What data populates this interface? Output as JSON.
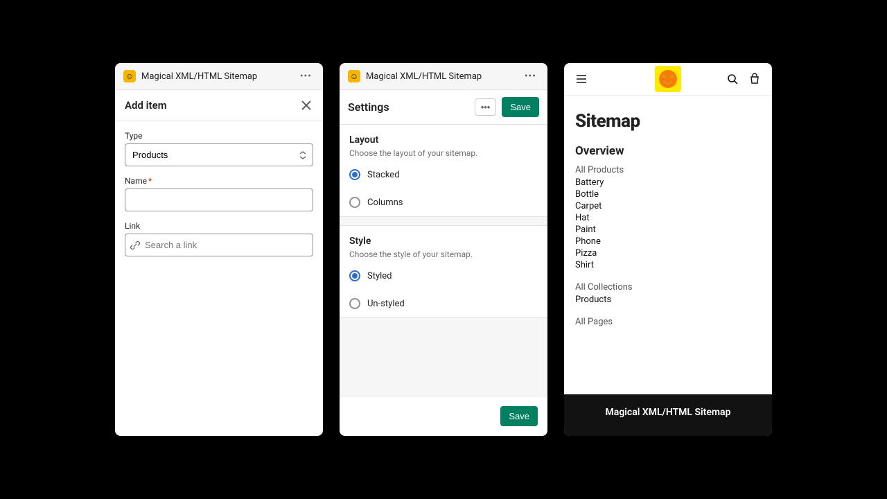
{
  "app_name": "Magical XML/HTML Sitemap",
  "panel1": {
    "title": "Add item",
    "type_label": "Type",
    "type_value": "Products",
    "name_label": "Name",
    "link_label": "Link",
    "link_placeholder": "Search a link"
  },
  "panel2": {
    "title": "Settings",
    "save_label": "Save",
    "layout": {
      "heading": "Layout",
      "desc": "Choose the layout of your sitemap.",
      "opt_stacked": "Stacked",
      "opt_columns": "Columns"
    },
    "style": {
      "heading": "Style",
      "desc": "Choose the style of your sitemap.",
      "opt_styled": "Styled",
      "opt_unstyled": "Un-styled"
    },
    "footer_save": "Save"
  },
  "panel3": {
    "page_title": "Sitemap",
    "overview_heading": "Overview",
    "all_products": "All Products",
    "products": [
      "Battery",
      "Bottle",
      "Carpet",
      "Hat",
      "Paint",
      "Phone",
      "Pizza",
      "Shirt"
    ],
    "all_collections": "All Collections",
    "collections": [
      "Products"
    ],
    "all_pages": "All Pages",
    "footer_text": "Magical XML/HTML Sitemap"
  }
}
